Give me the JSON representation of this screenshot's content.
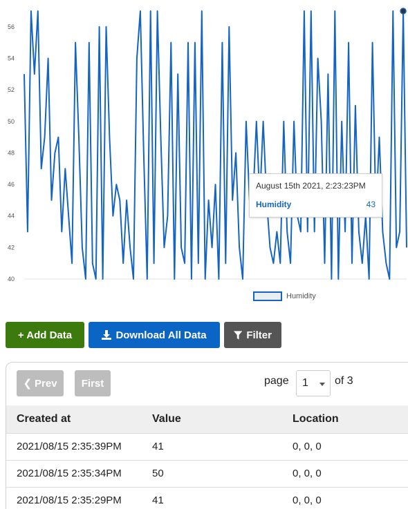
{
  "chart_data": {
    "type": "line",
    "series": [
      {
        "name": "Humidity",
        "values": [
          53,
          43,
          57,
          53,
          57,
          47,
          49,
          54,
          45,
          48,
          49,
          43,
          47,
          44,
          41,
          55,
          49,
          42,
          40,
          55,
          41,
          40,
          56,
          40,
          56,
          49,
          44,
          46,
          45,
          41,
          45,
          42,
          40,
          54,
          57,
          48,
          40,
          57,
          41,
          57,
          49,
          42,
          44,
          55,
          40,
          53,
          42,
          41,
          55,
          40,
          55,
          41,
          57,
          40,
          45,
          42,
          46,
          40,
          55,
          41,
          56,
          45,
          48,
          42,
          40,
          50,
          45,
          45,
          50,
          45,
          50,
          45,
          42,
          41,
          43,
          41,
          50,
          43,
          41,
          50,
          44,
          43,
          57,
          43,
          57,
          43,
          54,
          50,
          41,
          53,
          40,
          57,
          40,
          50,
          43,
          55,
          41,
          51,
          43,
          41,
          44,
          40,
          55,
          44,
          49,
          43,
          41,
          40,
          57,
          42,
          43,
          57,
          42
        ],
        "color": "#1565c0"
      }
    ],
    "y_ticks": [
      40,
      42,
      44,
      46,
      48,
      50,
      52,
      54,
      56
    ],
    "ylim": [
      40,
      57.7
    ],
    "legend": "bottom-center",
    "grid": false,
    "highlight_index": 111
  },
  "tooltip": {
    "title": "August 15th 2021, 2:23:23PM",
    "series": "Humidity",
    "value": "43"
  },
  "legend": {
    "label": "Humidity"
  },
  "toolbar": {
    "add_label": "+ Add Data",
    "download_label": "Download All Data",
    "filter_label": "Filter"
  },
  "pager": {
    "prev_label": "Prev",
    "first_label": "First",
    "page_label": "page",
    "page_value": "1",
    "page_of": "of 3"
  },
  "table": {
    "headers": [
      "Created at",
      "Value",
      "Location"
    ],
    "rows": [
      [
        "2021/08/15 2:35:39PM",
        "41",
        "0, 0, 0"
      ],
      [
        "2021/08/15 2:35:34PM",
        "50",
        "0, 0, 0"
      ],
      [
        "2021/08/15 2:35:29PM",
        "41",
        "0, 0, 0"
      ]
    ]
  },
  "colors": {
    "line": "#1565c0",
    "add_button": "#3d7a0e",
    "download_button": "#0b65c4",
    "filter_button": "#555555",
    "disabled_button": "#bdbdbd"
  }
}
